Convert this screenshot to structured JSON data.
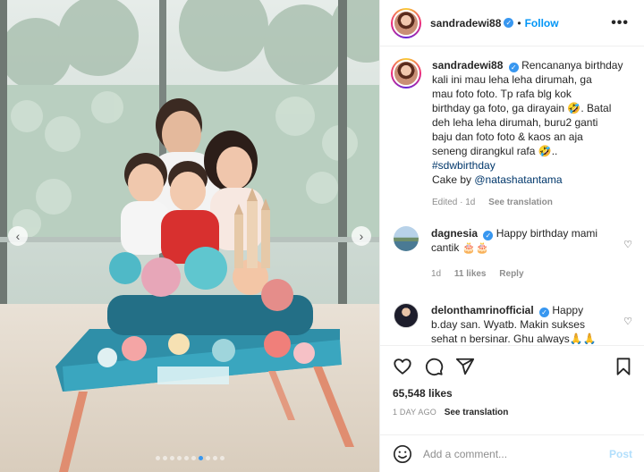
{
  "post": {
    "username": "sandradewi88",
    "follow_label": "Follow",
    "more_label": "•••",
    "verified_glyph": "✓",
    "caption_lines": [
      "Rencananya birthday",
      "kali ini mau leha leha dirumah, ga",
      "mau foto foto. Tp rafa blg kok",
      "birthday ga foto, ga dirayain 🤣. Batal",
      "deh leha leha dirumah, buru2 ganti",
      "baju dan foto foto & kaos an aja",
      "seneng dirangkul rafa 🤣.."
    ],
    "hashtag": "#sdwbirthday",
    "cake_prefix": "Cake by ",
    "cake_mention": "@natashatantama",
    "caption_edited": "Edited · 1d",
    "see_translation": "See translation"
  },
  "comments": [
    {
      "username": "dagnesia",
      "text_line1": "Happy birthday mami",
      "text_line2": "cantik 🎂🎂",
      "age": "1d",
      "likes": "11 likes",
      "reply": "Reply",
      "avatar": "lake-landscape"
    },
    {
      "username": "delonthamrinofficial",
      "text_line1": "Happy",
      "text_line2": "b.day san. Wyatb. Makin sukses",
      "text_line3": "sehat n bersinar. Ghu always🙏🙏",
      "avatar": "man-in-suit"
    }
  ],
  "actions": {
    "icons": [
      "heart-icon",
      "comment-icon",
      "share-icon",
      "bookmark-icon"
    ],
    "likes": "65,548 likes",
    "age": "1 DAY AGO",
    "see_translation": "See translation"
  },
  "add_comment": {
    "placeholder": "Add a comment...",
    "post_label": "Post"
  },
  "carousel": {
    "prev_label": "‹",
    "next_label": "›",
    "slide_count": 10,
    "active_index": 6
  },
  "colors": {
    "link_blue": "#0095f6",
    "verified_blue": "#3897f0",
    "muted": "#8e8e8e",
    "post_disabled": "#b2dffc"
  }
}
